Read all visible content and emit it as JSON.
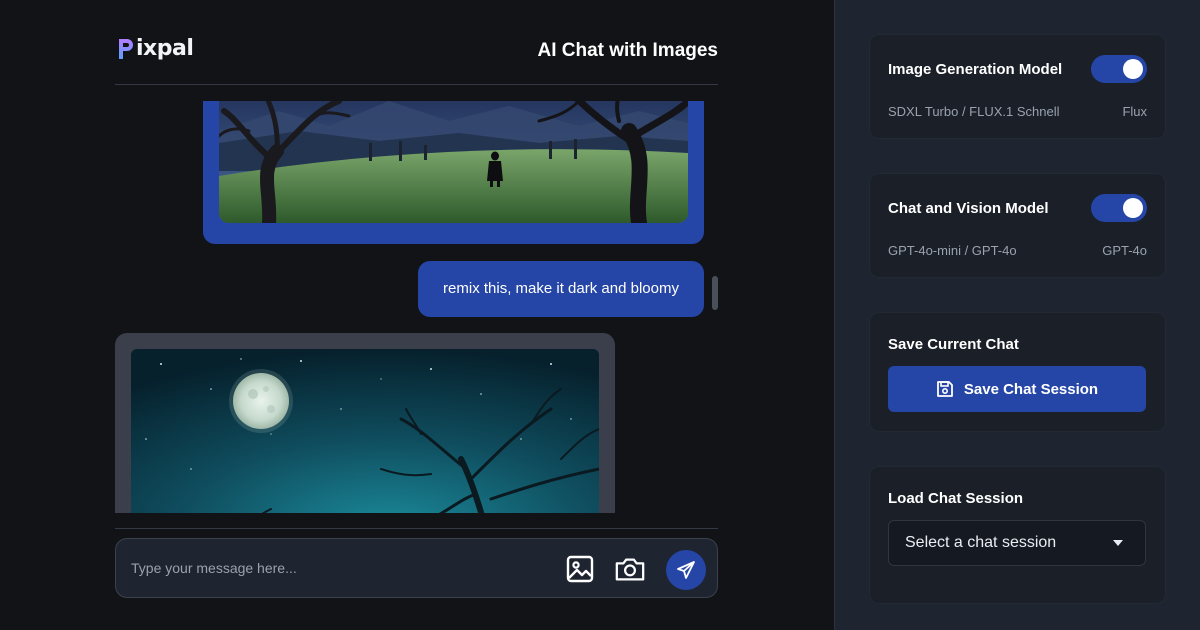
{
  "brand": {
    "name": "ixpal",
    "logo_letter": "P"
  },
  "header": {
    "title": "AI Chat with Images"
  },
  "chat": {
    "messages": [
      {
        "role": "assistant",
        "type": "image",
        "description": "landscape"
      },
      {
        "role": "user",
        "type": "text",
        "text": "remix this, make it dark and bloomy"
      },
      {
        "role": "assistant",
        "type": "image",
        "description": "moonlit"
      }
    ]
  },
  "composer": {
    "placeholder": "Type your message here...",
    "value": "",
    "icons": [
      "image-icon",
      "camera-icon",
      "send-icon"
    ]
  },
  "sidebar": {
    "image_model": {
      "title": "Image Generation Model",
      "enabled": true,
      "options_text": "SDXL Turbo / FLUX.1 Schnell",
      "selected": "Flux"
    },
    "chat_model": {
      "title": "Chat and Vision Model",
      "enabled": true,
      "options_text": "GPT-4o-mini / GPT-4o",
      "selected": "GPT-4o"
    },
    "save": {
      "title": "Save Current Chat",
      "button_label": "Save Chat Session",
      "icon": "floppy-disk-icon"
    },
    "load": {
      "title": "Load Chat Session",
      "select_value": "Select a chat session"
    }
  },
  "colors": {
    "accent": "#2546a6",
    "background": "#111316",
    "sidebar": "#1f2530",
    "card": "#1a1f28",
    "bubble_assistant": "#3a3f4b"
  }
}
